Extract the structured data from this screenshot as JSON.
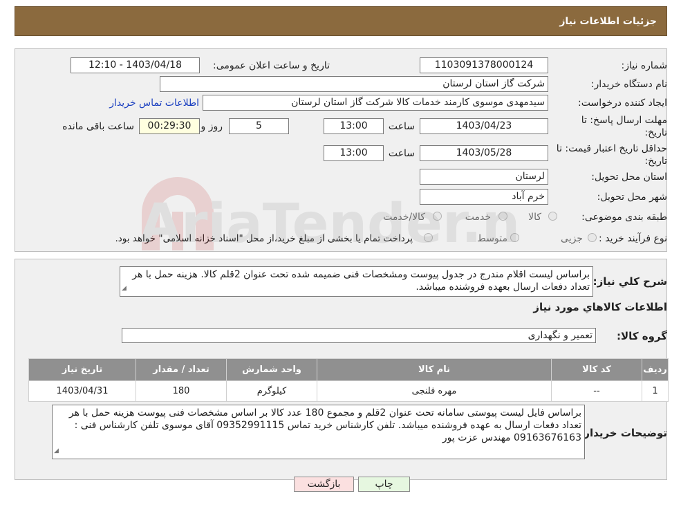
{
  "header": {
    "title": "جزئیات اطلاعات نیاز"
  },
  "form": {
    "need_number_label": "شماره نیاز:",
    "need_number": "1103091378000124",
    "announce_label": "تاریخ و ساعت اعلان عمومی:",
    "announce_value": "1403/04/18 - 12:10",
    "buyer_org_label": "نام دستگاه خریدار:",
    "buyer_org": "شرکت گاز استان لرستان",
    "creator_label": "ایجاد کننده درخواست:",
    "creator": "سیدمهدی موسوی کارمند خدمات کالا شرکت گاز استان لرستان",
    "contact_link": "اطلاعات تماس خریدار",
    "deadline_label_1": "مهلت ارسال پاسخ: تا",
    "deadline_label_2": "تاریخ:",
    "deadline_date": "1403/04/23",
    "time_label": "ساعت",
    "deadline_time": "13:00",
    "days_value": "5",
    "days_label": "روز و",
    "remaining_time": "00:29:30",
    "remaining_label": "ساعت باقی مانده",
    "validity_label_1": "حداقل تاریخ اعتبار قیمت: تا",
    "validity_label_2": "تاریخ:",
    "validity_date": "1403/05/28",
    "validity_time": "13:00",
    "province_label": "استان محل تحویل:",
    "province": "لرستان",
    "city_label": "شهر محل تحویل:",
    "city": "خرم آباد",
    "category_label": "طبقه بندی موضوعی:",
    "category_options": [
      "کالا",
      "خدمت",
      "کالا/خدمت"
    ],
    "process_label": "نوع فرآیند خرید :",
    "process_options": [
      "جزیی",
      "متوسط"
    ],
    "process_note": "پرداخت تمام یا بخشی از مبلغ خرید،از محل \"اسناد خزانه اسلامی\" خواهد بود."
  },
  "description": {
    "label": "شرح کلي نياز:",
    "text": "براساس لیست اقلام مندرج در جدول پیوست ومشخصات فنی ضمیمه شده تحت عنوان 2قلم کالا. هزینه حمل با هر تعداد دفعات ارسال بعهده فروشنده میباشد."
  },
  "goods": {
    "section_title": "اطلاعات کالاهاي مورد نياز",
    "group_label": "گروه کالا:",
    "group_value": "تعمیر و نگهداری",
    "columns": [
      "رديف",
      "کد کالا",
      "نام کالا",
      "واحد شمارش",
      "تعداد / مقدار",
      "تاریخ نیاز"
    ],
    "rows": [
      {
        "index": "1",
        "code": "--",
        "name": "مهره فلنجی",
        "unit": "کیلوگرم",
        "qty": "180",
        "date": "1403/04/31"
      }
    ]
  },
  "buyer_notes": {
    "label": "توضیحات خریدار:",
    "text": "براساس  فایل لیست پیوستی سامانه تحت عنوان 2قلم و مجموع 180 عدد کالا بر اساس مشخصات فنی پیوست هزینه حمل با هر تعداد دفعات ارسال به عهده فروشنده میباشد. تلفن کارشناس خرید تماس 09352991115 آقای موسوی تلفن کارشناس فنی : 09163676163 مهندس عزت پور"
  },
  "buttons": {
    "print": "چاپ",
    "back": "بازگشت"
  },
  "watermark": {
    "text": "AriaTender.neT"
  }
}
